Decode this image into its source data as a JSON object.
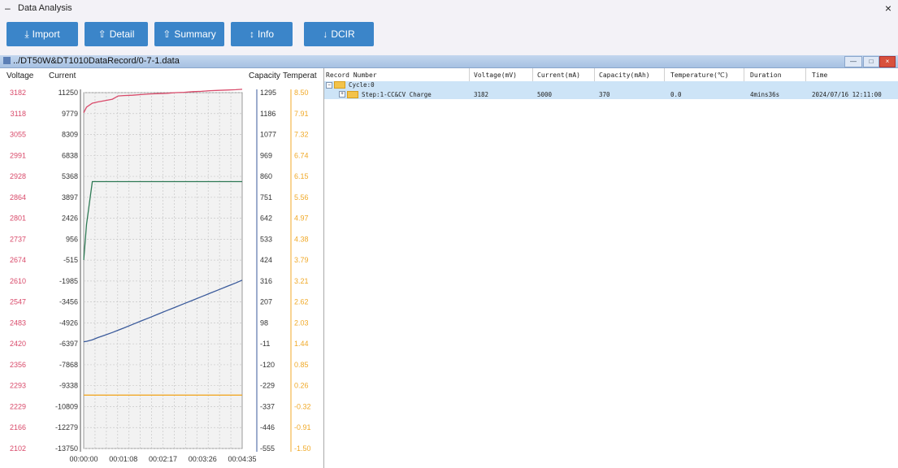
{
  "window": {
    "title": "Data Analysis",
    "minimize_glyph": "–",
    "close_glyph": "×"
  },
  "toolbar": {
    "buttons": [
      {
        "label": "Import",
        "icon": "import-icon",
        "glyph": "⤓"
      },
      {
        "label": "Detail",
        "icon": "export-icon",
        "glyph": "⇧"
      },
      {
        "label": "Summary",
        "icon": "export-icon",
        "glyph": "⇧"
      },
      {
        "label": "Info",
        "icon": "info-icon",
        "glyph": "↕"
      },
      {
        "label": "DCIR",
        "icon": "download-icon",
        "glyph": "↓"
      }
    ],
    "accent": "#3b85c9"
  },
  "file": {
    "path": "../DT50W&DT1010DataRecord/0-7-1.data"
  },
  "chart": {
    "headers": {
      "voltage": "Voltage",
      "current": "Current",
      "capacity": "Capacity",
      "temperature": "Temperat"
    },
    "voltage_ticks": [
      "3182",
      "3118",
      "3055",
      "2991",
      "2928",
      "2864",
      "2801",
      "2737",
      "2674",
      "2610",
      "2547",
      "2483",
      "2420",
      "2356",
      "2293",
      "2229",
      "2166",
      "2102"
    ],
    "current_ticks": [
      "11250",
      "9779",
      "8309",
      "6838",
      "5368",
      "3897",
      "2426",
      "956",
      "-515",
      "-1985",
      "-3456",
      "-4926",
      "-6397",
      "-7868",
      "-9338",
      "-10809",
      "-12279",
      "-13750"
    ],
    "capacity_ticks": [
      "1295",
      "1186",
      "1077",
      "969",
      "860",
      "751",
      "642",
      "533",
      "424",
      "316",
      "207",
      "98",
      "-11",
      "-120",
      "-229",
      "-337",
      "-446",
      "-555"
    ],
    "temperature_ticks": [
      "8.50",
      "7.91",
      "7.32",
      "6.74",
      "6.15",
      "5.56",
      "4.97",
      "4.38",
      "3.79",
      "3.21",
      "2.62",
      "2.03",
      "1.44",
      "0.85",
      "0.26",
      "-0.32",
      "-0.91",
      "-1.50"
    ],
    "x_ticks": [
      "00:00:00",
      "00:01:08",
      "00:02:17",
      "00:03:26",
      "00:04:35"
    ],
    "colors": {
      "voltage": "#d94a6a",
      "current": "#2f7a55",
      "capacity": "#3a5a9b",
      "temperature": "#f0a928"
    }
  },
  "chart_data": {
    "type": "line",
    "x_unit": "seconds",
    "x": [
      0,
      5,
      15,
      25,
      35,
      50,
      60,
      70,
      85,
      100,
      115,
      130,
      145,
      160,
      175,
      190,
      205,
      220,
      235,
      250,
      265,
      276
    ],
    "xlim": [
      0,
      276
    ],
    "series": [
      {
        "name": "Voltage",
        "axis": "Voltage",
        "values": [
          3121,
          3138,
          3150,
          3154,
          3157,
          3162,
          3172,
          3173,
          3174,
          3176,
          3178,
          3179,
          3180,
          3182,
          3183,
          3185,
          3186,
          3188,
          3189,
          3190,
          3191,
          3192
        ],
        "ylim": [
          2102,
          3182
        ]
      },
      {
        "name": "Current",
        "axis": "Current",
        "values": [
          -500,
          2000,
          5000,
          5000,
          5000,
          5000,
          5000,
          5000,
          5000,
          5000,
          5000,
          5000,
          5000,
          5000,
          5000,
          5000,
          5000,
          5000,
          5000,
          5000,
          5000,
          5000
        ],
        "ylim": [
          -13750,
          11250
        ]
      },
      {
        "name": "Capacity",
        "axis": "Capacity",
        "values": [
          0,
          2,
          10,
          22,
          32,
          48,
          60,
          72,
          90,
          108,
          126,
          144,
          162,
          180,
          198,
          216,
          234,
          252,
          270,
          288,
          306,
          320
        ],
        "ylim": [
          -555,
          1295
        ]
      },
      {
        "name": "Temperature",
        "axis": "Temperature",
        "values": [
          0.0,
          0.0,
          0.0,
          0.0,
          0.0,
          0.0,
          0.0,
          0.0,
          0.0,
          0.0,
          0.0,
          0.0,
          0.0,
          0.0,
          0.0,
          0.0,
          0.0,
          0.0,
          0.0,
          0.0,
          0.0,
          0.0
        ],
        "ylim": [
          -1.5,
          8.5
        ]
      }
    ],
    "grid": true
  },
  "table": {
    "columns": [
      "Record Number",
      "Voltage(mV)",
      "Current(mA)",
      "Capacity(mAh)",
      "Temperature(℃)",
      "Duration",
      "Time"
    ],
    "cycle_label": "Cycle:0",
    "step": {
      "label": "Step:1-CC&CV Charge",
      "voltage": "3182",
      "current": "5000",
      "capacity": "370",
      "temperature": "0.0",
      "duration": "4mins36s",
      "time": "2024/07/16 12:11:00"
    },
    "selection_color": "#cde4f7"
  }
}
